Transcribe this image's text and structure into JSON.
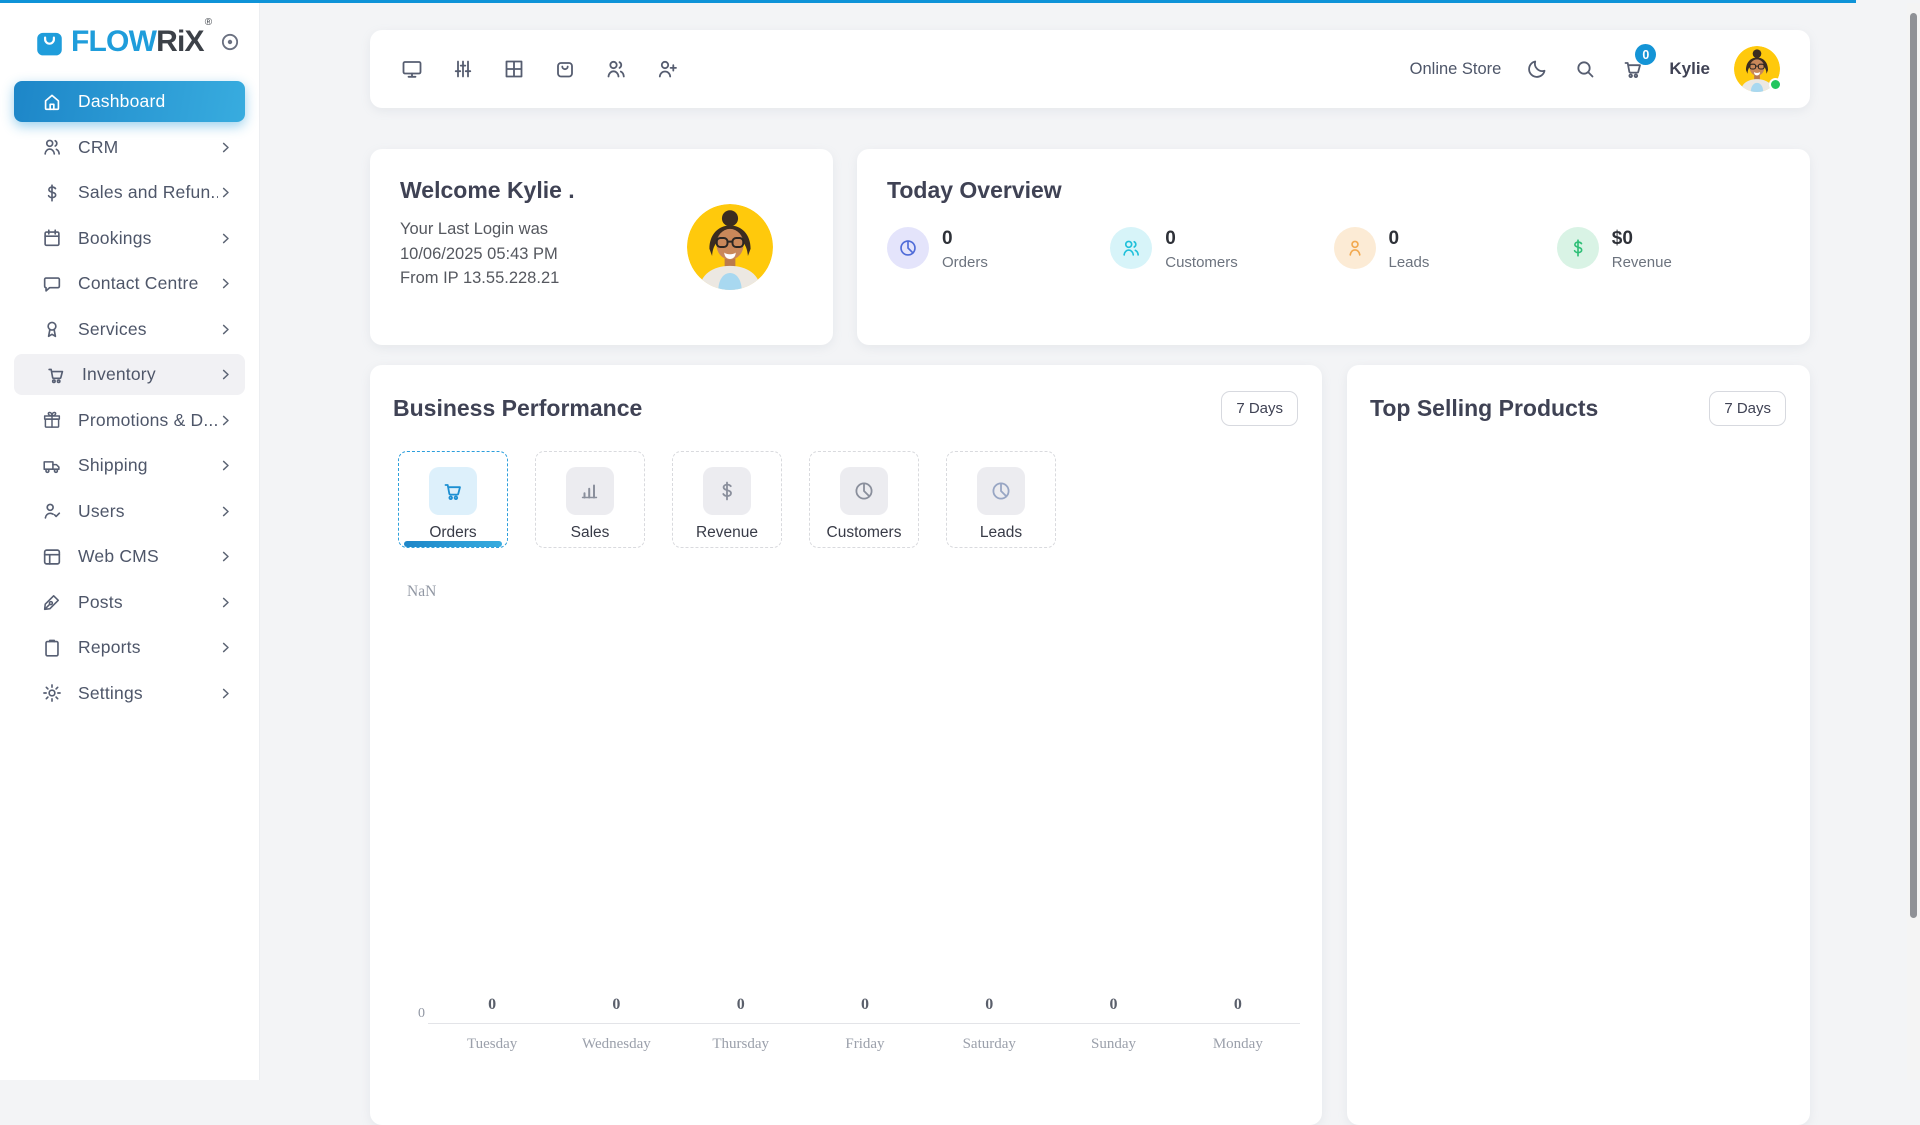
{
  "brand": {
    "flow": "FLOW",
    "rix": "RiX",
    "reg": "®"
  },
  "colors": {
    "accent_blue": "#1494d6",
    "top_progress_line": "#0e93d8",
    "sidebar_active_gradient_from": "#1d86c8",
    "sidebar_active_gradient_to": "#38acdf",
    "stat_orders_bg": "#e4e4fb",
    "stat_orders_icon": "#4f6bd8",
    "stat_customers_bg": "#d7f4f9",
    "stat_customers_icon": "#1fc0da",
    "stat_leads_bg": "#fcebd5",
    "stat_leads_icon": "#f2a950",
    "stat_revenue_bg": "#d9f3e5",
    "stat_revenue_icon": "#2fbf77",
    "online_dot": "#23c65f",
    "cart_badge_bg": "#1494d6"
  },
  "sidebar": {
    "items": [
      {
        "label": "Dashboard",
        "icon": "home-icon",
        "active": true
      },
      {
        "label": "CRM",
        "icon": "users-icon"
      },
      {
        "label": "Sales and Refun...",
        "icon": "dollar-icon"
      },
      {
        "label": "Bookings",
        "icon": "calendar-icon"
      },
      {
        "label": "Contact Centre",
        "icon": "chat-icon"
      },
      {
        "label": "Services",
        "icon": "medal-icon"
      },
      {
        "label": "Inventory",
        "icon": "cart-icon",
        "hovered": true
      },
      {
        "label": "Promotions & D...",
        "icon": "gift-icon"
      },
      {
        "label": "Shipping",
        "icon": "truck-icon"
      },
      {
        "label": "Users",
        "icon": "user-check-icon"
      },
      {
        "label": "Web CMS",
        "icon": "layout-icon"
      },
      {
        "label": "Posts",
        "icon": "pen-icon"
      },
      {
        "label": "Reports",
        "icon": "clipboard-icon"
      },
      {
        "label": "Settings",
        "icon": "gear-icon"
      }
    ]
  },
  "topbar": {
    "icons": [
      "monitor-icon",
      "sliders-icon",
      "grid-icon",
      "bag-icon",
      "customers-icon",
      "add-user-icon"
    ],
    "online_store": "Online Store",
    "cart_badge": "0",
    "username": "Kylie"
  },
  "welcome": {
    "title": "Welcome Kylie .",
    "line1": "Your Last Login was",
    "line2": "10/06/2025 05:43 PM",
    "line3": "From IP 13.55.228.21"
  },
  "today": {
    "title": "Today Overview",
    "stats": [
      {
        "value": "0",
        "label": "Orders"
      },
      {
        "value": "0",
        "label": "Customers"
      },
      {
        "value": "0",
        "label": "Leads"
      },
      {
        "value": "$0",
        "label": "Revenue"
      }
    ]
  },
  "performance": {
    "title": "Business Performance",
    "range_button": "7 Days",
    "tabs": [
      {
        "label": "Orders",
        "active": true
      },
      {
        "label": "Sales"
      },
      {
        "label": "Revenue"
      },
      {
        "label": "Customers"
      },
      {
        "label": "Leads"
      }
    ]
  },
  "top_products": {
    "title": "Top Selling Products",
    "range_button": "7 Days"
  },
  "chart_data": {
    "type": "bar",
    "title": "Business Performance - Orders (7 Days)",
    "categories": [
      "Tuesday",
      "Wednesday",
      "Thursday",
      "Friday",
      "Saturday",
      "Sunday",
      "Monday"
    ],
    "values": [
      0,
      0,
      0,
      0,
      0,
      0,
      0
    ],
    "xlabel": "",
    "ylabel": "",
    "ylim": [
      0,
      0
    ],
    "y_axis_zero": "0",
    "annotation": "NaN",
    "grid": false,
    "legend": false
  }
}
